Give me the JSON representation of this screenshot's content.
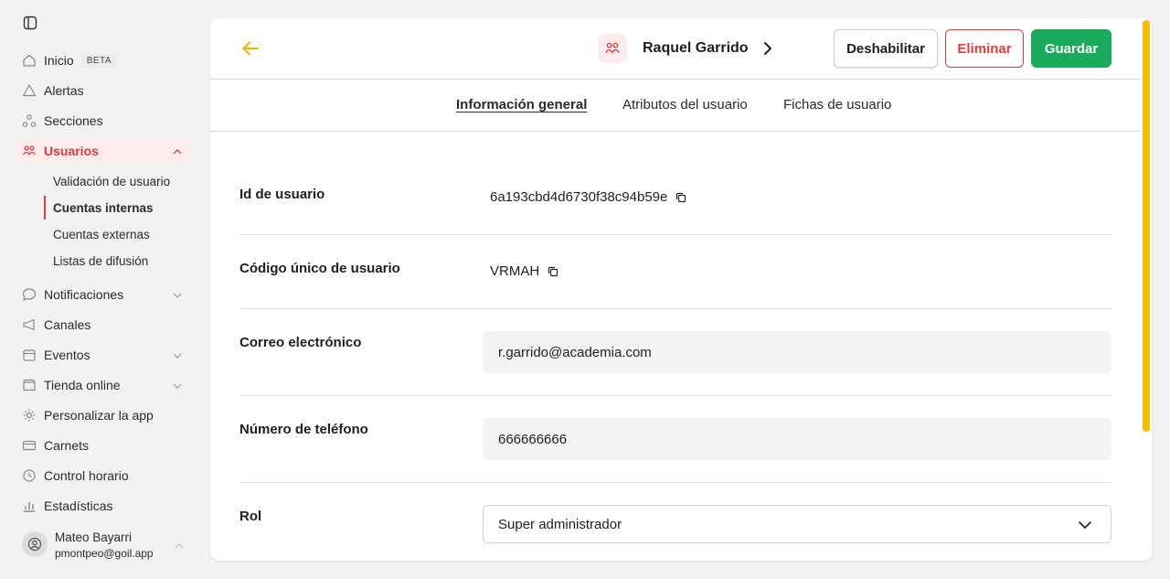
{
  "colors": {
    "accent": "#e23c3c",
    "save": "#1cab5c",
    "scrollbar": "#f5bf00",
    "back_arrow": "#f0b400"
  },
  "sidebar": {
    "items": [
      {
        "label": "Inicio",
        "icon": "home-icon",
        "badge": "BETA"
      },
      {
        "label": "Alertas",
        "icon": "alert-icon"
      },
      {
        "label": "Secciones",
        "icon": "sections-icon"
      },
      {
        "label": "Usuarios",
        "icon": "users-icon"
      },
      {
        "label": "Notificaciones",
        "icon": "chat-icon"
      },
      {
        "label": "Canales",
        "icon": "megaphone-icon"
      },
      {
        "label": "Eventos",
        "icon": "calendar-icon"
      },
      {
        "label": "Tienda online",
        "icon": "store-icon"
      },
      {
        "label": "Personalizar la app",
        "icon": "customize-icon"
      },
      {
        "label": "Carnets",
        "icon": "card-icon"
      },
      {
        "label": "Control horario",
        "icon": "clock-icon"
      },
      {
        "label": "Estadísticas",
        "icon": "stats-icon"
      }
    ],
    "subitems": [
      {
        "label": "Validación de usuario"
      },
      {
        "label": "Cuentas internas"
      },
      {
        "label": "Cuentas externas"
      },
      {
        "label": "Listas de difusión"
      }
    ],
    "user": {
      "name": "Mateo Bayarri",
      "email": "pmontpeo@goil.app"
    }
  },
  "header": {
    "name": "Raquel Garrido",
    "buttons": {
      "disable": "Deshabilitar",
      "delete": "Eliminar",
      "save": "Guardar"
    }
  },
  "tabs": [
    {
      "label": "Información general"
    },
    {
      "label": "Atributos del usuario"
    },
    {
      "label": "Fichas de usuario"
    }
  ],
  "form": {
    "id": {
      "label": "Id de usuario",
      "value": "6a193cbd4d6730f38c94b59e"
    },
    "code": {
      "label": "Código único de usuario",
      "value": "VRMAH"
    },
    "email": {
      "label": "Correo electrónico",
      "value": "r.garrido@academia.com"
    },
    "phone": {
      "label": "Número de teléfono",
      "value": "666666666"
    },
    "role": {
      "label": "Rol",
      "value": "Super administrador"
    }
  }
}
